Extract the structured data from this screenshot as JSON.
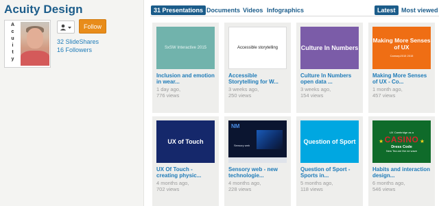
{
  "profile": {
    "name": "Acuity Design",
    "logo_letters": [
      "A",
      "c",
      "u",
      "i",
      "t",
      "y"
    ],
    "follow_label": "Follow",
    "slideshares": "32 SlideShares",
    "followers": "16 Followers",
    "follow_options_icon": "user-dropdown-icon"
  },
  "tabs": {
    "presentations": "31 Presentations",
    "documents": "Documents",
    "videos": "Videos",
    "infographics": "Infographics",
    "latest": "Latest",
    "most_viewed": "Most viewed"
  },
  "cards": [
    {
      "thumb_text": "SxSW Interactive 2015",
      "title": "Inclusion and emotion in wear...",
      "age": "1 day ago,",
      "views": "776 views",
      "thumb_color": "#71b3ac"
    },
    {
      "thumb_text": "Accessible storytelling",
      "title": "Accessible Storytelling for W...",
      "age": "3 weeks ago,",
      "views": "250 views",
      "thumb_color": "#ffffff"
    },
    {
      "thumb_text": "Culture In Numbers",
      "title": "Culture In Numbers open data ...",
      "age": "3 weeks ago,",
      "views": "154 views",
      "thumb_color": "#7b5ca8"
    },
    {
      "thumb_text": "Making More Senses of UX",
      "thumb_sub": "Camsep2015 2015",
      "title": "Making More Senses of UX - Co...",
      "age": "1 month ago,",
      "views": "457 views",
      "thumb_color": "#ef6e14"
    },
    {
      "thumb_text": "UX of Touch",
      "title": "UX Of Touch - creating physic...",
      "age": "4 months ago,",
      "views": "702 views",
      "thumb_color": "#15286b"
    },
    {
      "thumb_text": "Sensory web",
      "thumb_logo": "NM",
      "title": "Sensory web - new technologie...",
      "age": "4 months ago,",
      "views": "228 views",
      "thumb_color": "#0b1530"
    },
    {
      "thumb_text": "Question of Sport",
      "title": "Question of Sport - Sports in...",
      "age": "5 months ago,",
      "views": "118 views",
      "thumb_color": "#00a7e1"
    },
    {
      "thumb_text": "CASINO",
      "thumb_top": "UX Cambridge as a",
      "thumb_mid": "Dress Code",
      "thumb_bottom": "New Tea are the ne wave",
      "title": "Habits and interaction design...",
      "age": "6 months ago,",
      "views": "546 views",
      "thumb_color": "#0f6b2a"
    }
  ]
}
